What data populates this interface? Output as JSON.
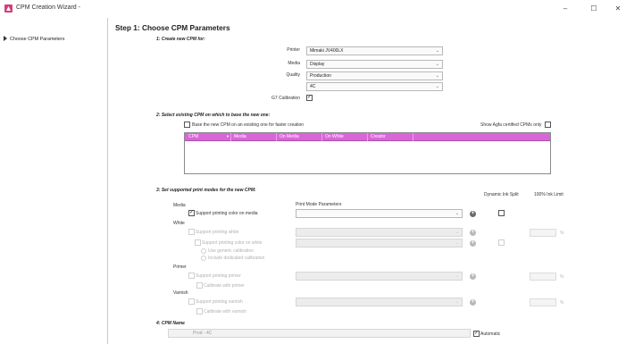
{
  "window": {
    "title": "CPM Creation Wizard -",
    "minimize": "–",
    "maximize": "☐",
    "close": "✕",
    "accent": "#d966d9"
  },
  "sidebar": {
    "items": [
      {
        "label": "Choose CPM Parameters"
      }
    ]
  },
  "main": {
    "heading": "Step 1: Choose CPM Parameters",
    "section1": {
      "title": "1: Create new CPM for:",
      "printer_label": "Printer",
      "printer_value": "Mimaki JV400LX",
      "media_label": "Media",
      "media_value": "Display",
      "quality_label": "Quality",
      "quality_value": "Production",
      "mode_value": "4C",
      "g7_label": "G7 Calibration",
      "g7_checked": "✓"
    },
    "section2": {
      "title": "2: Select existing CPM on which to base the new one:",
      "base_label": "Base the new CPM on an existing one for faster creation",
      "agfa_label": "Show Agfa certified CPMs only",
      "columns": [
        "CPM",
        "Media",
        "On Media",
        "On White",
        "Creator"
      ],
      "sort_indicator": "▼"
    },
    "section3": {
      "title": "3: Set supported print modes for the new CPM:",
      "col_dynamic": "Dynamic Ink Split",
      "col_limit": "100% Ink Limit",
      "col_params": "Print Mode Parameters",
      "media_group": "Media",
      "support_media": "Support printing color on media",
      "support_media_checked": "✓",
      "white_group": "White",
      "support_white": "Support printing white",
      "support_color_white": "Support printing color on white",
      "use_generic": "Use generic calibration",
      "include_dedicated": "Include dedicated calibration",
      "primer_group": "Primer",
      "support_primer": "Support printing primer",
      "calibrate_primer": "Calibrate with primer",
      "varnish_group": "Varnish",
      "support_varnish": "Support printing varnish",
      "calibrate_varnish": "Calibrate with varnish",
      "percent": "%",
      "add": "+"
    },
    "section4": {
      "title": "4: CPM Name",
      "name_value": "Prod - 4C",
      "automatic_label": "Automatic",
      "automatic_checked": "✓"
    }
  }
}
